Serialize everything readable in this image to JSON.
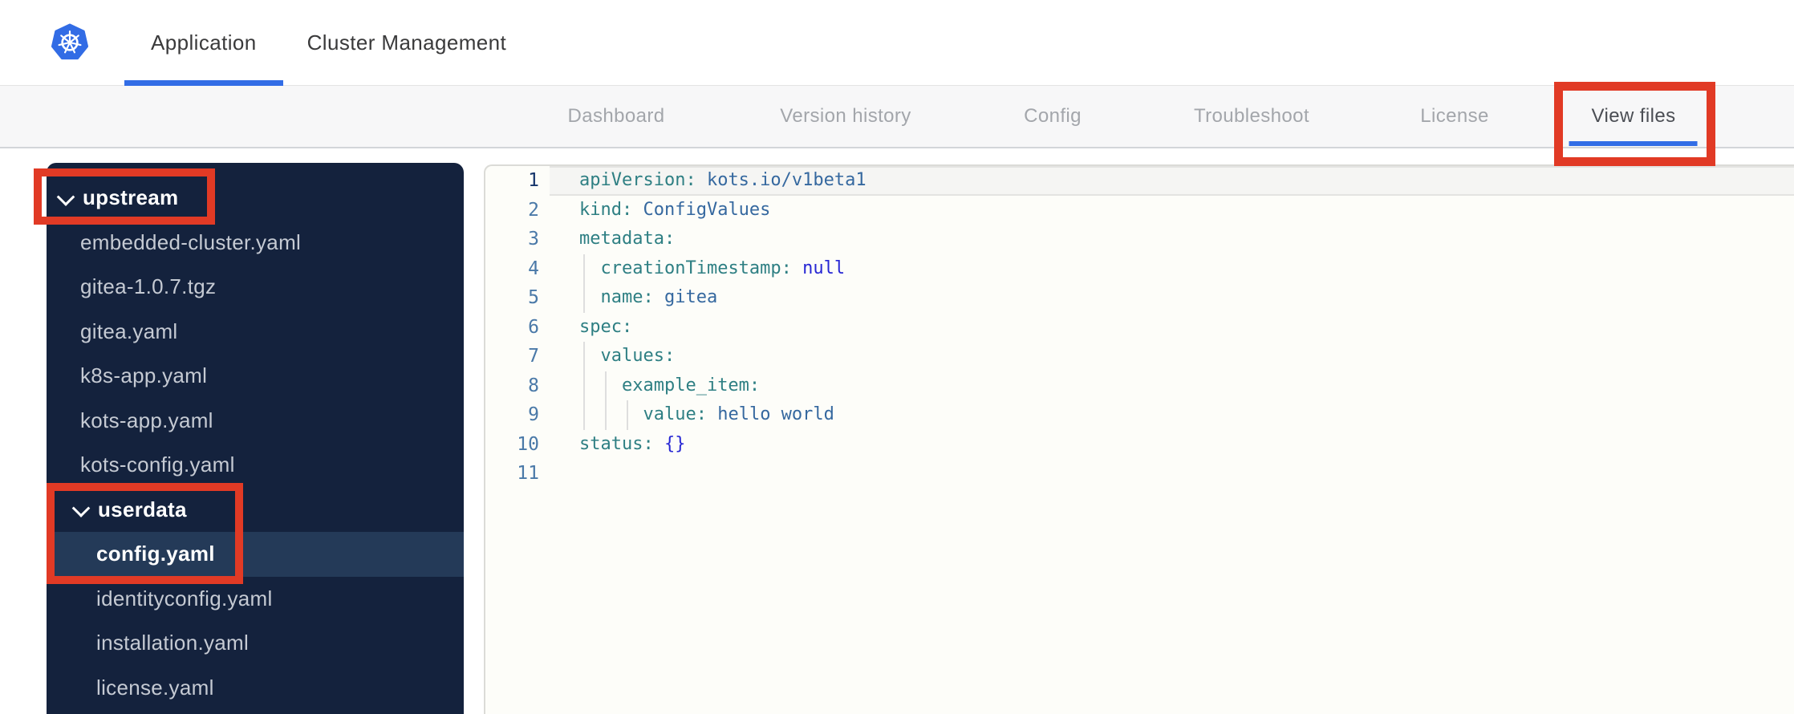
{
  "theme": {
    "accent_blue": "#326de6",
    "annotation_red": "#e13a25",
    "sidebar_bg": "#14223d",
    "sidebar_selected_bg": "#243a58",
    "code_key_color": "#2e7f83",
    "code_value_color": "#35689f",
    "code_keyword_color": "#2727d4",
    "gutter_color": "#4a79a8",
    "gutter_active_color": "#15356b",
    "logo_blue": "#326ce5"
  },
  "header": {
    "logo": "kubernetes-logo",
    "tabs": [
      {
        "label": "Application",
        "active": true
      },
      {
        "label": "Cluster Management",
        "active": false
      }
    ]
  },
  "subnav": {
    "items": [
      {
        "label": "Dashboard",
        "active": false
      },
      {
        "label": "Version history",
        "active": false
      },
      {
        "label": "Config",
        "active": false
      },
      {
        "label": "Troubleshoot",
        "active": false
      },
      {
        "label": "License",
        "active": false
      },
      {
        "label": "View files",
        "active": true
      }
    ]
  },
  "file_tree": {
    "items": [
      {
        "label": "upstream",
        "folder": true,
        "level": 0,
        "expanded": true
      },
      {
        "label": "embedded-cluster.yaml",
        "folder": false,
        "level": 1
      },
      {
        "label": "gitea-1.0.7.tgz",
        "folder": false,
        "level": 1
      },
      {
        "label": "gitea.yaml",
        "folder": false,
        "level": 1
      },
      {
        "label": "k8s-app.yaml",
        "folder": false,
        "level": 1
      },
      {
        "label": "kots-app.yaml",
        "folder": false,
        "level": 1
      },
      {
        "label": "kots-config.yaml",
        "folder": false,
        "level": 1
      },
      {
        "label": "userdata",
        "folder": true,
        "level": 1,
        "expanded": true
      },
      {
        "label": "config.yaml",
        "folder": false,
        "level": 2,
        "selected": true
      },
      {
        "label": "identityconfig.yaml",
        "folder": false,
        "level": 2
      },
      {
        "label": "installation.yaml",
        "folder": false,
        "level": 2
      },
      {
        "label": "license.yaml",
        "folder": false,
        "level": 2
      }
    ]
  },
  "editor": {
    "language": "yaml",
    "lines": [
      {
        "num": "1",
        "active": true,
        "guides": 0,
        "tokens": [
          {
            "c": "key",
            "t": "apiVersion:"
          },
          {
            "c": "val",
            "t": " kots.io/v1beta1"
          }
        ]
      },
      {
        "num": "2",
        "guides": 0,
        "tokens": [
          {
            "c": "key",
            "t": "kind:"
          },
          {
            "c": "val",
            "t": " ConfigValues"
          }
        ]
      },
      {
        "num": "3",
        "guides": 0,
        "tokens": [
          {
            "c": "key",
            "t": "metadata:"
          }
        ]
      },
      {
        "num": "4",
        "guides": 1,
        "tokens": [
          {
            "c": "plain",
            "t": "  "
          },
          {
            "c": "key",
            "t": "creationTimestamp:"
          },
          {
            "c": "kw",
            "t": " null"
          }
        ]
      },
      {
        "num": "5",
        "guides": 1,
        "tokens": [
          {
            "c": "plain",
            "t": "  "
          },
          {
            "c": "key",
            "t": "name:"
          },
          {
            "c": "val",
            "t": " gitea"
          }
        ]
      },
      {
        "num": "6",
        "guides": 0,
        "tokens": [
          {
            "c": "key",
            "t": "spec:"
          }
        ]
      },
      {
        "num": "7",
        "guides": 1,
        "tokens": [
          {
            "c": "plain",
            "t": "  "
          },
          {
            "c": "key",
            "t": "values:"
          }
        ]
      },
      {
        "num": "8",
        "guides": 2,
        "tokens": [
          {
            "c": "plain",
            "t": "    "
          },
          {
            "c": "key",
            "t": "example_item:"
          }
        ]
      },
      {
        "num": "9",
        "guides": 3,
        "tokens": [
          {
            "c": "plain",
            "t": "      "
          },
          {
            "c": "key",
            "t": "value:"
          },
          {
            "c": "val",
            "t": " hello world"
          }
        ]
      },
      {
        "num": "10",
        "guides": 0,
        "tokens": [
          {
            "c": "key",
            "t": "status:"
          },
          {
            "c": "kw",
            "t": " {}"
          }
        ]
      },
      {
        "num": "11",
        "guides": 0,
        "tokens": []
      }
    ]
  },
  "annotations": {
    "color": "#e13a25",
    "boxes": [
      "view-files-tab",
      "upstream-folder",
      "userdata-and-config-yaml"
    ]
  }
}
